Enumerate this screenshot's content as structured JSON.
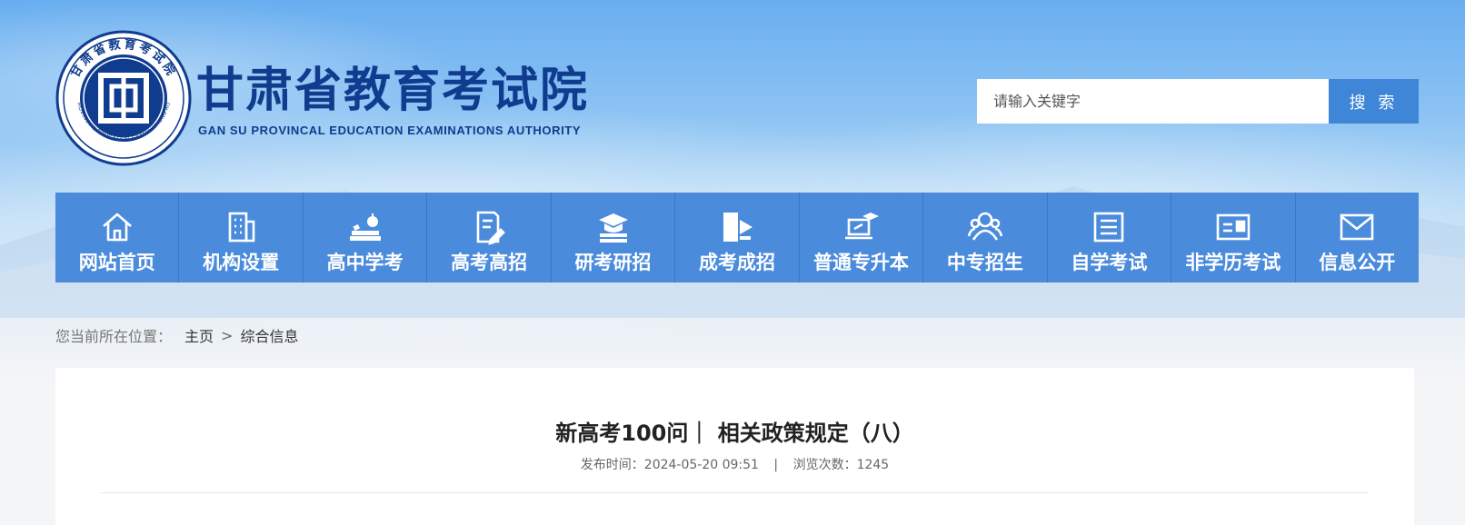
{
  "header": {
    "site_title": "甘肃省教育考试院",
    "site_subtitle": "GAN SU PROVINCAL EDUCATION EXAMINATIONS AUTHORITY",
    "seal_text": "甘肃省教育考试院",
    "seal_text_en": "GANSU PROVINCIAL EDUCATION EXAMINATIONS AUTHORITY",
    "seal_char": "回"
  },
  "search": {
    "placeholder": "请输入关键字",
    "button_label": "搜 索"
  },
  "nav": {
    "items": [
      {
        "label": "网站首页",
        "icon": "home-icon"
      },
      {
        "label": "机构设置",
        "icon": "building-icon"
      },
      {
        "label": "高中学考",
        "icon": "books-icon"
      },
      {
        "label": "高考高招",
        "icon": "document-pen-icon"
      },
      {
        "label": "研考研招",
        "icon": "graduation-cap-icon"
      },
      {
        "label": "成考成招",
        "icon": "book-flag-icon"
      },
      {
        "label": "普通专升本",
        "icon": "laptop-cap-icon"
      },
      {
        "label": "中专招生",
        "icon": "users-icon"
      },
      {
        "label": "自学考试",
        "icon": "notebook-icon"
      },
      {
        "label": "非学历考试",
        "icon": "id-card-icon"
      },
      {
        "label": "信息公开",
        "icon": "envelope-icon"
      }
    ]
  },
  "breadcrumb": {
    "prefix": "您当前所在位置：",
    "home": "主页",
    "separator": ">",
    "current": "综合信息"
  },
  "article": {
    "title": "新高考100问｜ 相关政策规定（八）",
    "publish_label": "发布时间：",
    "publish_time": "2024-05-20 09:51",
    "meta_separator": "|",
    "views_label": "浏览次数：",
    "views": "1245"
  },
  "colors": {
    "nav_bg": "#4a8bdc",
    "search_button": "#3f86d9",
    "title_blue": "#0f3c8e"
  }
}
